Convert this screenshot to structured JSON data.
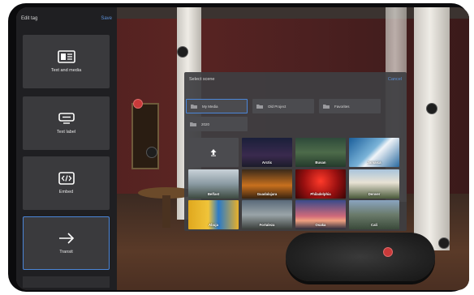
{
  "panel": {
    "title": "Edit tag",
    "action": "Save",
    "tags": [
      {
        "label": "Text and media",
        "icon": "text-and-media-icon"
      },
      {
        "label": "Text label",
        "icon": "text-label-icon"
      },
      {
        "label": "Embed",
        "icon": "embed-icon"
      },
      {
        "label": "Transit",
        "icon": "arrow-right-icon",
        "selected": true
      }
    ]
  },
  "modal": {
    "title": "Select scene",
    "cancel": "Cancel",
    "folders": [
      {
        "label": "My Media",
        "selected": true
      },
      {
        "label": "Old Project"
      },
      {
        "label": "Favorites"
      },
      {
        "label": "2020"
      }
    ],
    "upload_icon": "upload-icon",
    "scenes": [
      "Arctic",
      "Busan",
      "Jamaica",
      "Belfast",
      "Guadalajara",
      "Philadelphia",
      "Denver",
      "Abuja",
      "Fortaleza",
      "Osaka",
      "Cali"
    ]
  },
  "colors": {
    "accent": "#4b86d8",
    "panel_bg": "#1f1f22",
    "tile_bg": "#3a3a3d"
  }
}
